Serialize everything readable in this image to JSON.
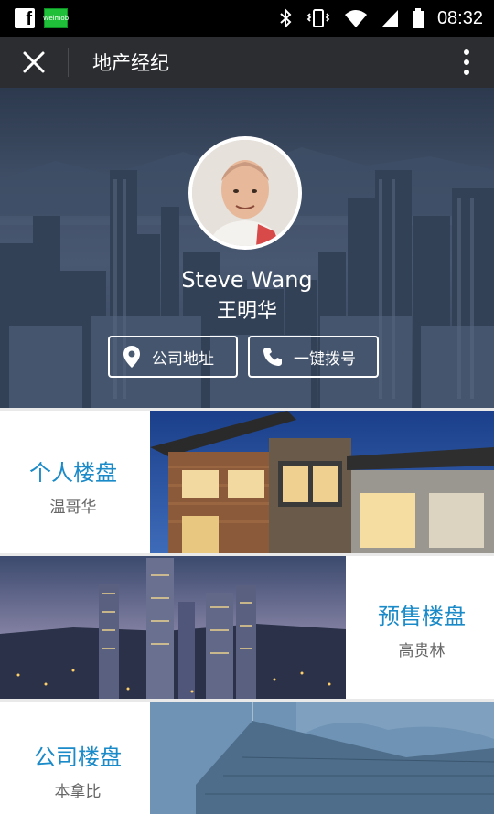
{
  "status_bar": {
    "fb_icon": "facebook-icon",
    "app_icon_label": "Weimob",
    "time": "08:32"
  },
  "app_bar": {
    "title": "地产经纪"
  },
  "agent": {
    "name_en": "Steve Wang",
    "name_cn": "王明华",
    "address_label": "公司地址",
    "call_label": "一键拨号"
  },
  "listings": [
    {
      "title": "个人楼盘",
      "subtitle": "温哥华"
    },
    {
      "title": "预售楼盘",
      "subtitle": "高贵林"
    },
    {
      "title": "公司楼盘",
      "subtitle": "本拿比"
    }
  ],
  "colors": {
    "accent": "#1a8ac8",
    "app_bar": "#2b2d31",
    "status_bar": "#000000"
  }
}
